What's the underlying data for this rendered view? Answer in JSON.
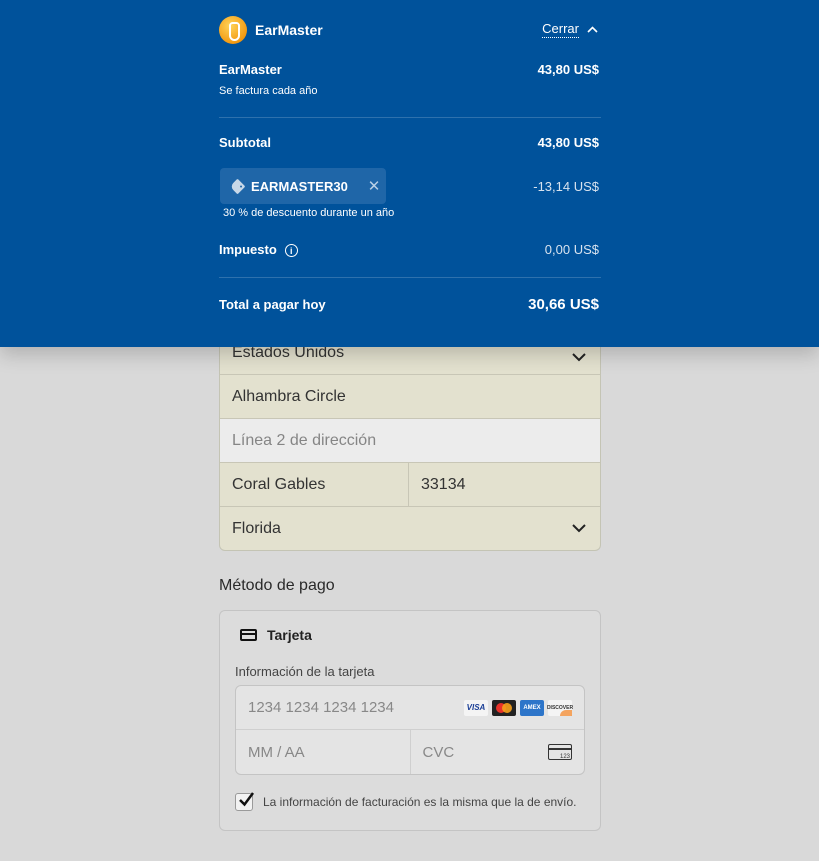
{
  "summary": {
    "brand": "EarMaster",
    "close_label": "Cerrar",
    "product_name": "EarMaster",
    "product_price": "43,80 US$",
    "billing_period": "Se factura cada año",
    "subtotal_label": "Subtotal",
    "subtotal_value": "43,80 US$",
    "coupon_code": "EARMASTER30",
    "coupon_discount": "-13,14 US$",
    "coupon_description": "30 % de descuento durante un año",
    "tax_label": "Impuesto",
    "tax_value": "0,00 US$",
    "total_label": "Total a pagar hoy",
    "total_value": "30,66 US$"
  },
  "address": {
    "country": "Estados Unidos",
    "line1": "Alhambra Circle",
    "line2_placeholder": "Línea 2 de dirección",
    "city": "Coral Gables",
    "zip": "33134",
    "state": "Florida"
  },
  "payment": {
    "section_title": "Método de pago",
    "method_label": "Tarjeta",
    "card_info_label": "Información de la tarjeta",
    "card_number_placeholder": "1234 1234 1234 1234",
    "expiry_placeholder": "MM / AA",
    "cvc_placeholder": "CVC",
    "cvc_icon_text": "123",
    "brands": [
      "VISA",
      "",
      "AMEX",
      "DISCOVER"
    ],
    "same_billing_text": "La información de facturación es la misma que la de envío.",
    "same_billing_checked": true
  },
  "colors": {
    "panel_bg": "#00529b",
    "coupon_bg": "#1f66a8",
    "autofill_bg": "#e3e1cf"
  }
}
